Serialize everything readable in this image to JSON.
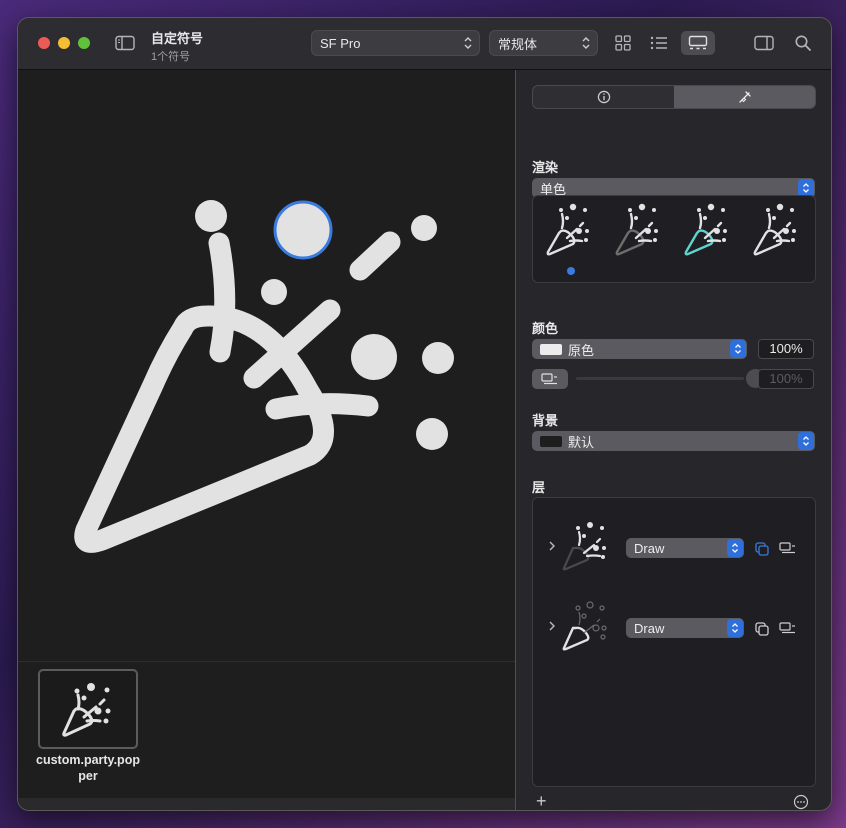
{
  "window": {
    "title": "自定符号",
    "subtitle": "1个符号"
  },
  "toolbar": {
    "font_select": "SF Pro",
    "weight_select": "常规体",
    "icons": [
      "sidebar-icon",
      "grid-view-icon",
      "list-view-icon",
      "gallery-view-icon",
      "inspector-toggle-icon",
      "search-icon"
    ],
    "active_view": "gallery"
  },
  "canvas": {
    "symbol": "custom.party.popper",
    "selected_element": "confetti-dot"
  },
  "library": {
    "items": [
      {
        "label": "custom.party.popper",
        "selected": true
      }
    ]
  },
  "inspector": {
    "tabs": [
      {
        "icon": "info-icon",
        "active": false
      },
      {
        "icon": "paintbrush-icon",
        "active": true
      }
    ],
    "rendering": {
      "label": "渲染",
      "value": "单色",
      "modes": [
        {
          "name": "monochrome",
          "selected": true
        },
        {
          "name": "hierarchical",
          "selected": false
        },
        {
          "name": "palette",
          "selected": false
        },
        {
          "name": "multicolor",
          "selected": false
        }
      ]
    },
    "color": {
      "label": "颜色",
      "value": "原色",
      "opacity": "100%",
      "secondary_opacity": "100%",
      "accent_color": "#3a7be0"
    },
    "background": {
      "label": "背景",
      "value": "默认"
    },
    "layers": {
      "label": "层",
      "items": [
        {
          "mode": "Draw",
          "highlighted_copy": true
        },
        {
          "mode": "Draw",
          "highlighted_copy": false
        }
      ]
    },
    "footer": {
      "add_label": "+",
      "more_icon": "ellipsis-circle-icon"
    }
  }
}
